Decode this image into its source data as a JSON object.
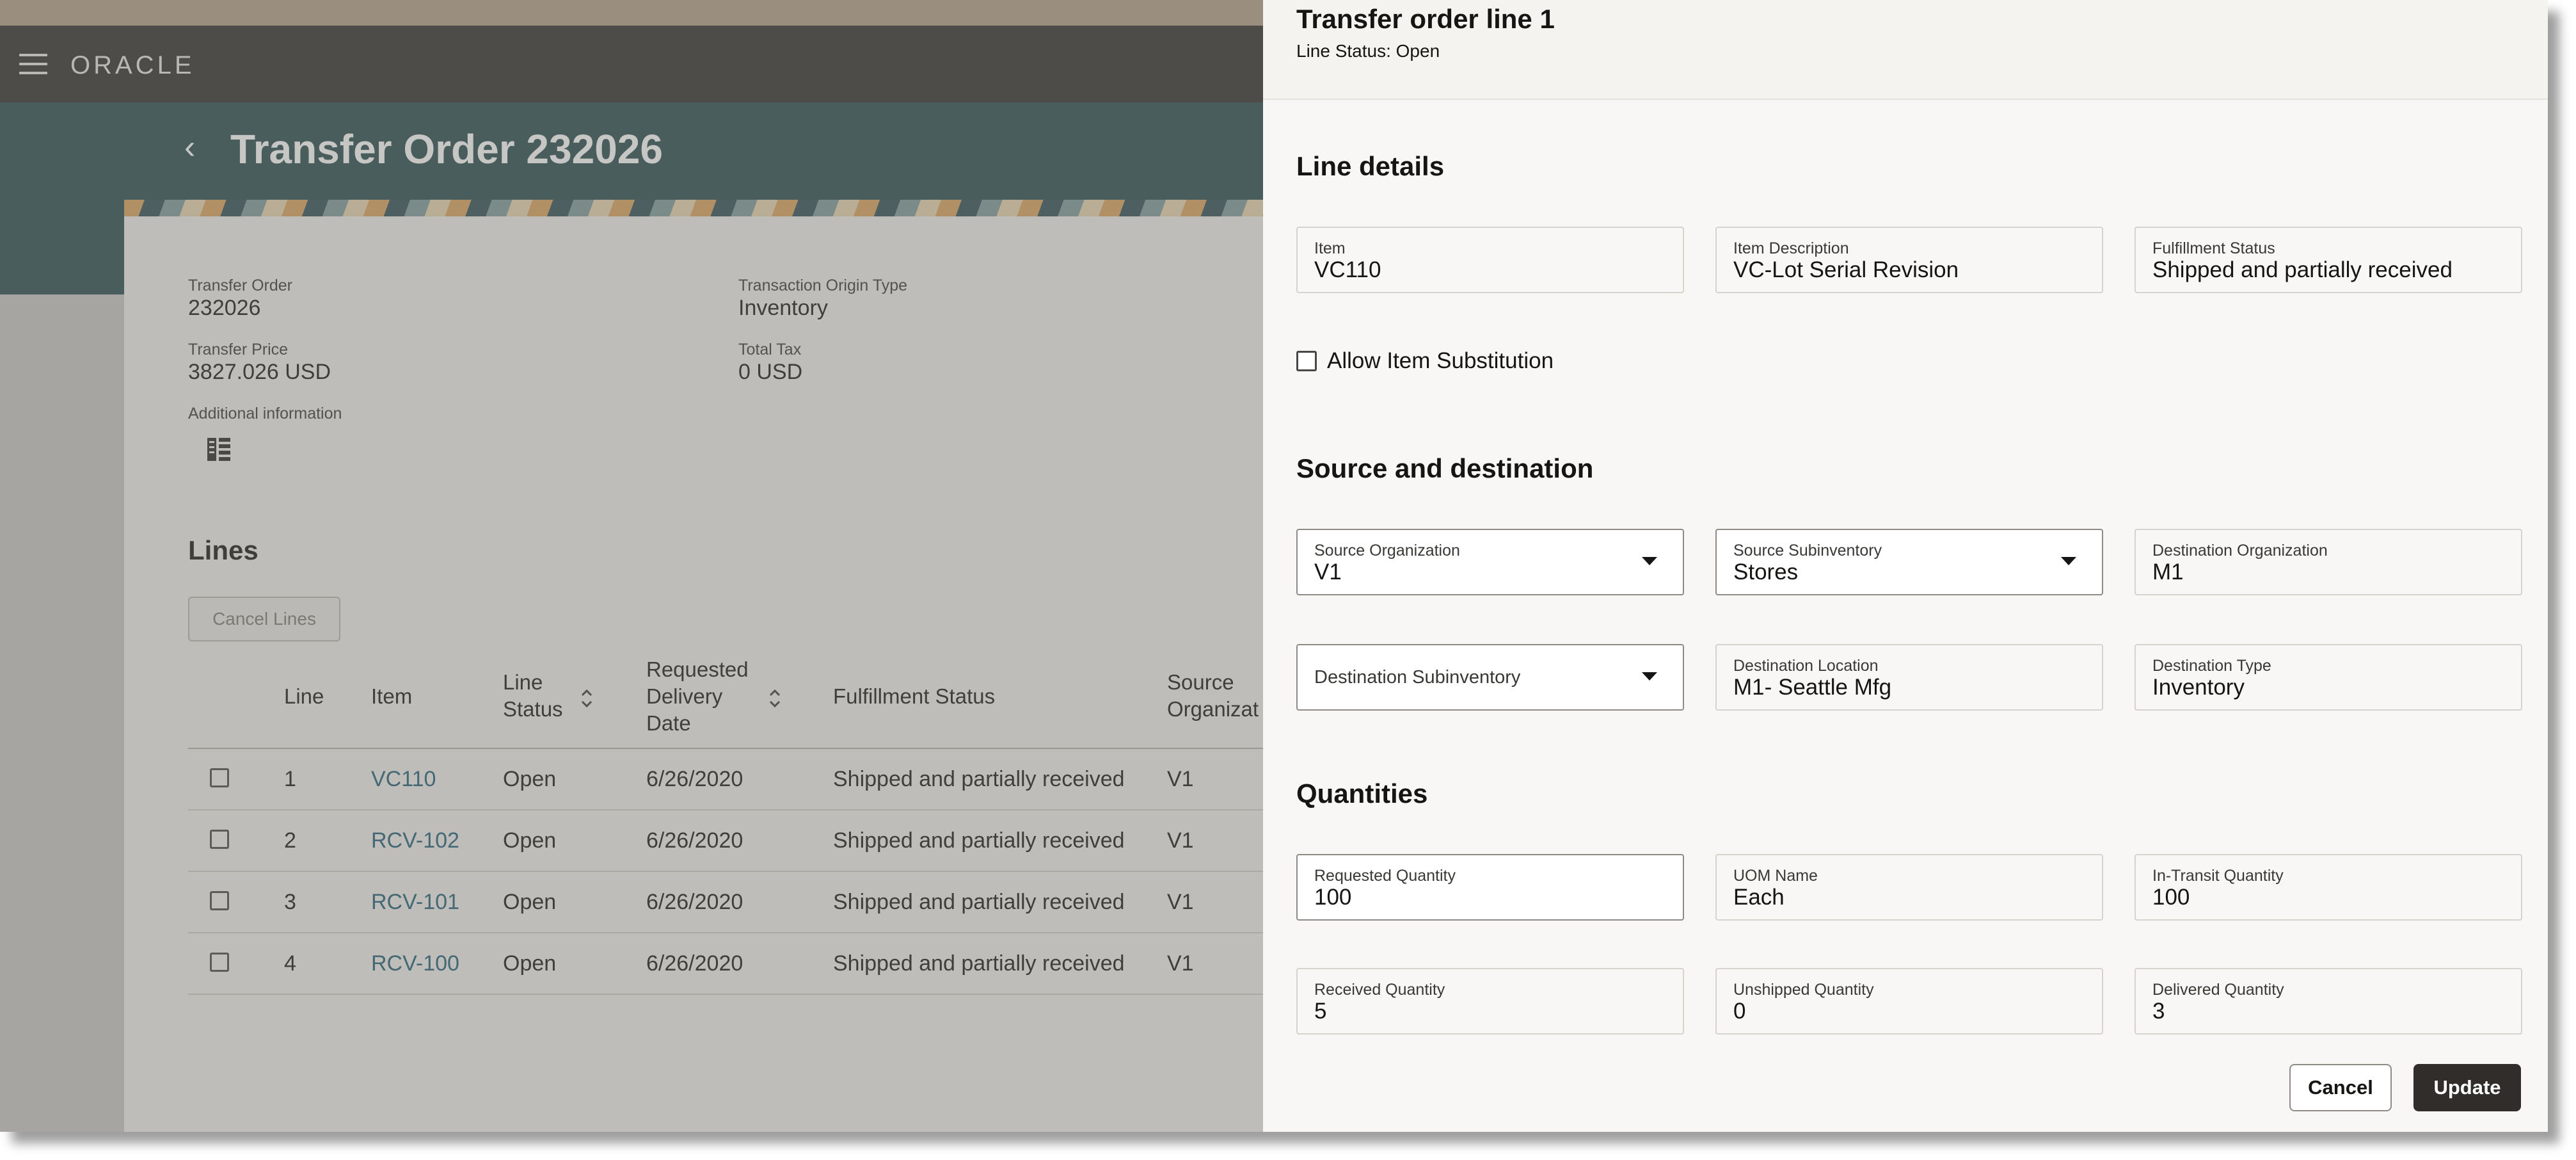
{
  "app": {
    "logo_text": "ORACLE"
  },
  "page": {
    "title": "Transfer Order 232026",
    "summary": [
      {
        "label": "Transfer Order",
        "value": "232026"
      },
      {
        "label": "Transaction Origin Type",
        "value": "Inventory"
      },
      {
        "label": "Transfer Price",
        "value": "3827.026 USD"
      },
      {
        "label": "Total Tax",
        "value": "0 USD"
      }
    ],
    "additional_info_label": "Additional information"
  },
  "lines": {
    "title": "Lines",
    "cancel_button": "Cancel Lines",
    "headers": {
      "line": "Line",
      "item": "Item",
      "line_status_1": "Line",
      "line_status_2": "Status",
      "req_date_1": "Requested",
      "req_date_2": "Delivery",
      "req_date_3": "Date",
      "fulfillment": "Fulfillment Status",
      "source_org_1": "Source",
      "source_org_2": "Organizat"
    },
    "rows": [
      {
        "line": "1",
        "item": "VC110",
        "status": "Open",
        "date": "6/26/2020",
        "fulfillment": "Shipped and partially received",
        "source": "V1"
      },
      {
        "line": "2",
        "item": "RCV-102",
        "status": "Open",
        "date": "6/26/2020",
        "fulfillment": "Shipped and partially received",
        "source": "V1"
      },
      {
        "line": "3",
        "item": "RCV-101",
        "status": "Open",
        "date": "6/26/2020",
        "fulfillment": "Shipped and partially received",
        "source": "V1"
      },
      {
        "line": "4",
        "item": "RCV-100",
        "status": "Open",
        "date": "6/26/2020",
        "fulfillment": "Shipped and partially received",
        "source": "V1"
      }
    ]
  },
  "drawer": {
    "title": "Transfer order line 1",
    "status": "Line Status: Open",
    "line_details": {
      "title": "Line details",
      "item": {
        "label": "Item",
        "value": "VC110"
      },
      "item_description": {
        "label": "Item Description",
        "value": "VC-Lot Serial Revision"
      },
      "fulfillment_status": {
        "label": "Fulfillment Status",
        "value": "Shipped and partially received"
      },
      "allow_substitution": "Allow Item Substitution"
    },
    "source_destination": {
      "title": "Source and destination",
      "source_org": {
        "label": "Source Organization",
        "value": "V1"
      },
      "source_subinv": {
        "label": "Source Subinventory",
        "value": "Stores"
      },
      "dest_org": {
        "label": "Destination Organization",
        "value": "M1"
      },
      "dest_subinv": {
        "label": "Destination Subinventory"
      },
      "dest_location": {
        "label": "Destination Location",
        "value": "M1- Seattle Mfg"
      },
      "dest_type": {
        "label": "Destination Type",
        "value": "Inventory"
      }
    },
    "quantities": {
      "title": "Quantities",
      "requested": {
        "label": "Requested Quantity",
        "value": "100"
      },
      "uom": {
        "label": "UOM Name",
        "value": "Each"
      },
      "in_transit": {
        "label": "In-Transit Quantity",
        "value": "100"
      },
      "received": {
        "label": "Received Quantity",
        "value": "5"
      },
      "unshipped": {
        "label": "Unshipped Quantity",
        "value": "0"
      },
      "delivered": {
        "label": "Delivered Quantity",
        "value": "3"
      }
    },
    "buttons": {
      "cancel": "Cancel",
      "update": "Update"
    }
  }
}
